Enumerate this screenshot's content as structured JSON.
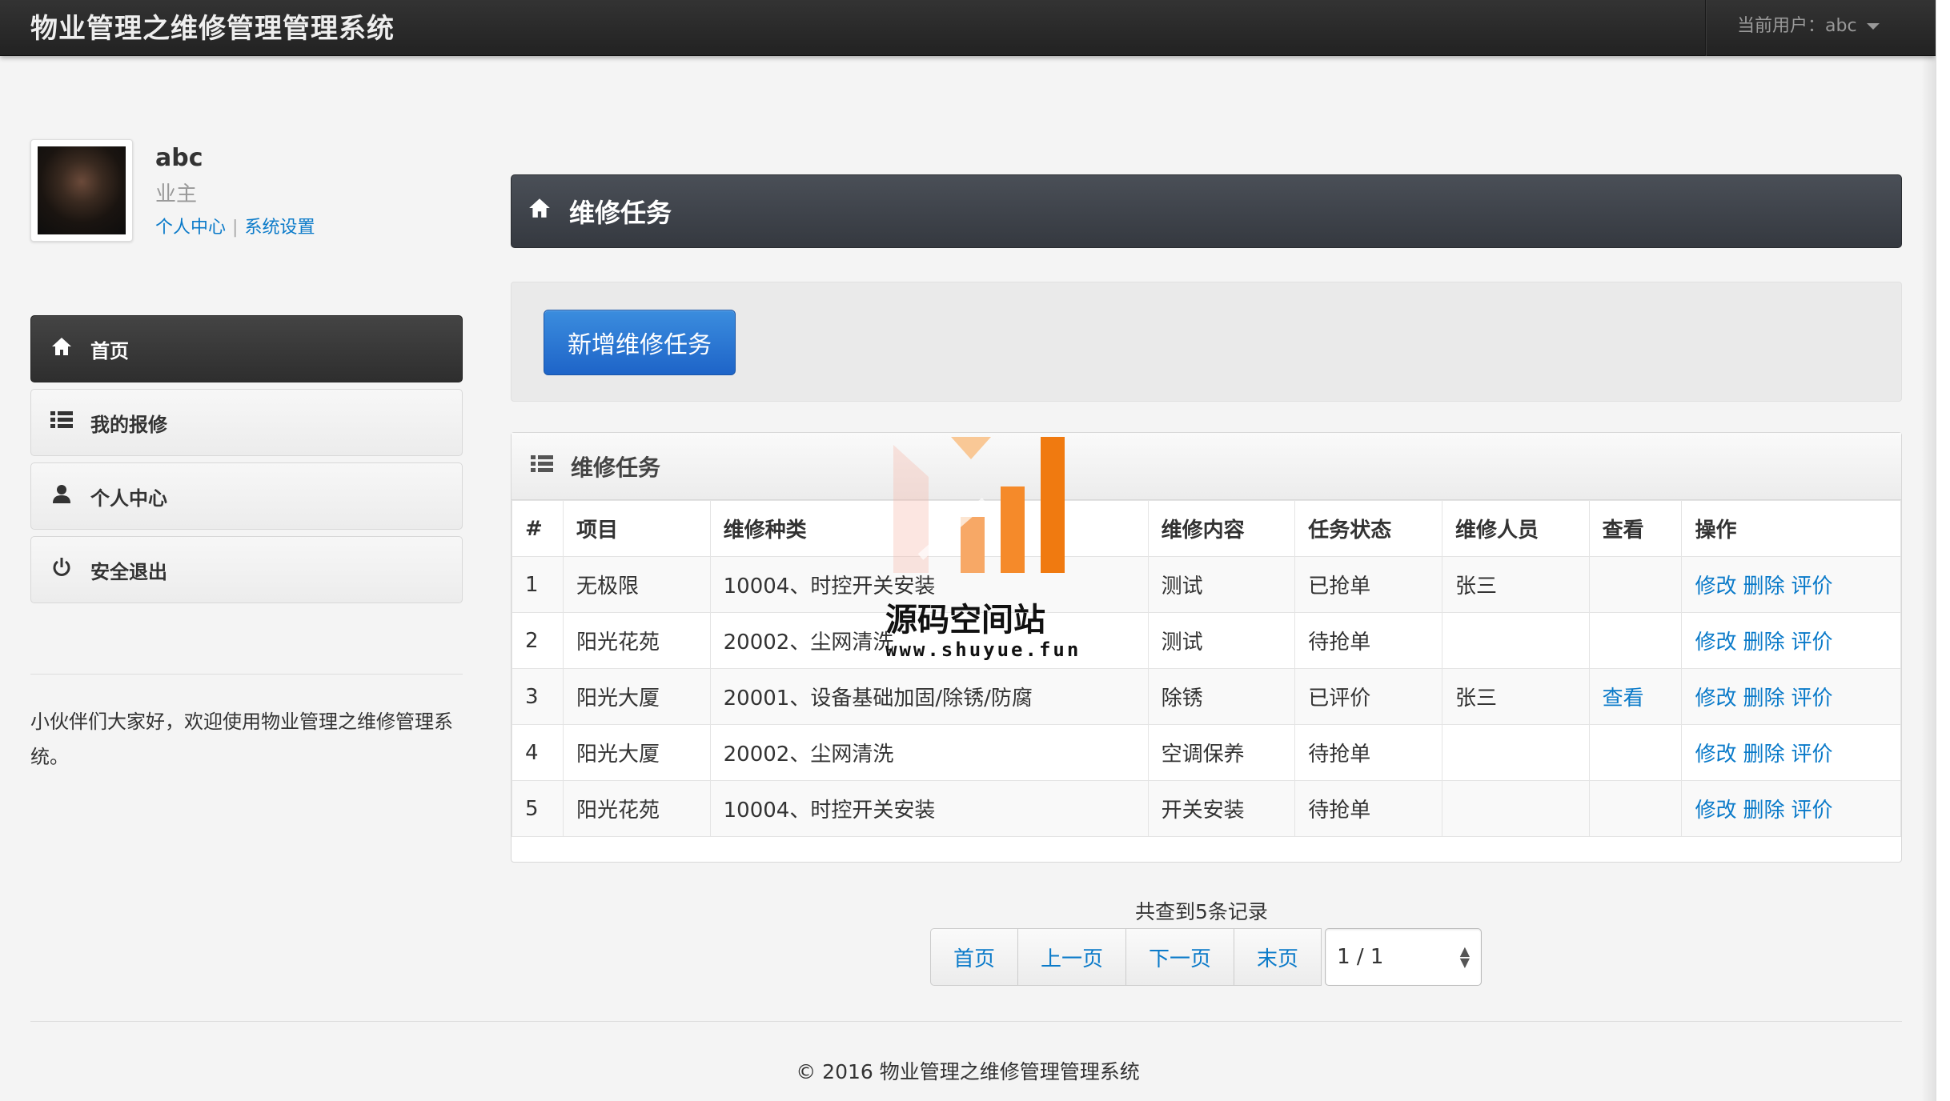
{
  "navbar": {
    "brand": "物业管理之维修管理管理系统",
    "current_user": "当前用户：abc"
  },
  "profile": {
    "name": "abc",
    "role": "业主",
    "link_personal": "个人中心",
    "link_settings": "系统设置"
  },
  "sidebar": {
    "items": [
      {
        "label": "首页",
        "icon": "home-icon"
      },
      {
        "label": "我的报修",
        "icon": "list-icon"
      },
      {
        "label": "个人中心",
        "icon": "user-icon"
      },
      {
        "label": "安全退出",
        "icon": "power-icon"
      }
    ],
    "welcome": "小伙伴们大家好，欢迎使用物业管理之维修管理系统。"
  },
  "main": {
    "page_title": "维修任务",
    "add_button": "新增维修任务",
    "widget_title": "维修任务",
    "table": {
      "headers": [
        "#",
        "项目",
        "维修种类",
        "维修内容",
        "任务状态",
        "维修人员",
        "查看",
        "操作"
      ],
      "rows": [
        {
          "no": "1",
          "project": "无极限",
          "category": "10004、时控开关安装",
          "content": "测试",
          "status": "已抢单",
          "worker": "张三",
          "view": ""
        },
        {
          "no": "2",
          "project": "阳光花苑",
          "category": "20002、尘网清洗",
          "content": "测试",
          "status": "待抢单",
          "worker": "",
          "view": ""
        },
        {
          "no": "3",
          "project": "阳光大厦",
          "category": "20001、设备基础加固/除锈/防腐",
          "content": "除锈",
          "status": "已评价",
          "worker": "张三",
          "view": "查看"
        },
        {
          "no": "4",
          "project": "阳光大厦",
          "category": "20002、尘网清洗",
          "content": "空调保养",
          "status": "待抢单",
          "worker": "",
          "view": ""
        },
        {
          "no": "5",
          "project": "阳光花苑",
          "category": "10004、时控开关安装",
          "content": "开关安装",
          "status": "待抢单",
          "worker": "",
          "view": ""
        }
      ],
      "ops": {
        "edit": "修改",
        "delete": "删除",
        "rate": "评价"
      }
    }
  },
  "watermark": {
    "text": "源码空间站",
    "url": "www.shuyue.fun"
  },
  "pagination": {
    "summary": "共查到5条记录",
    "first": "首页",
    "prev": "上一页",
    "next": "下一页",
    "last": "末页",
    "page_select": "1 / 1"
  },
  "footer": {
    "copyright": "© 2016 物业管理之维修管理管理系统"
  },
  "colors": {
    "link": "#0a7ac9",
    "primary_button": "#1e64c8",
    "navbar": "#222222"
  }
}
